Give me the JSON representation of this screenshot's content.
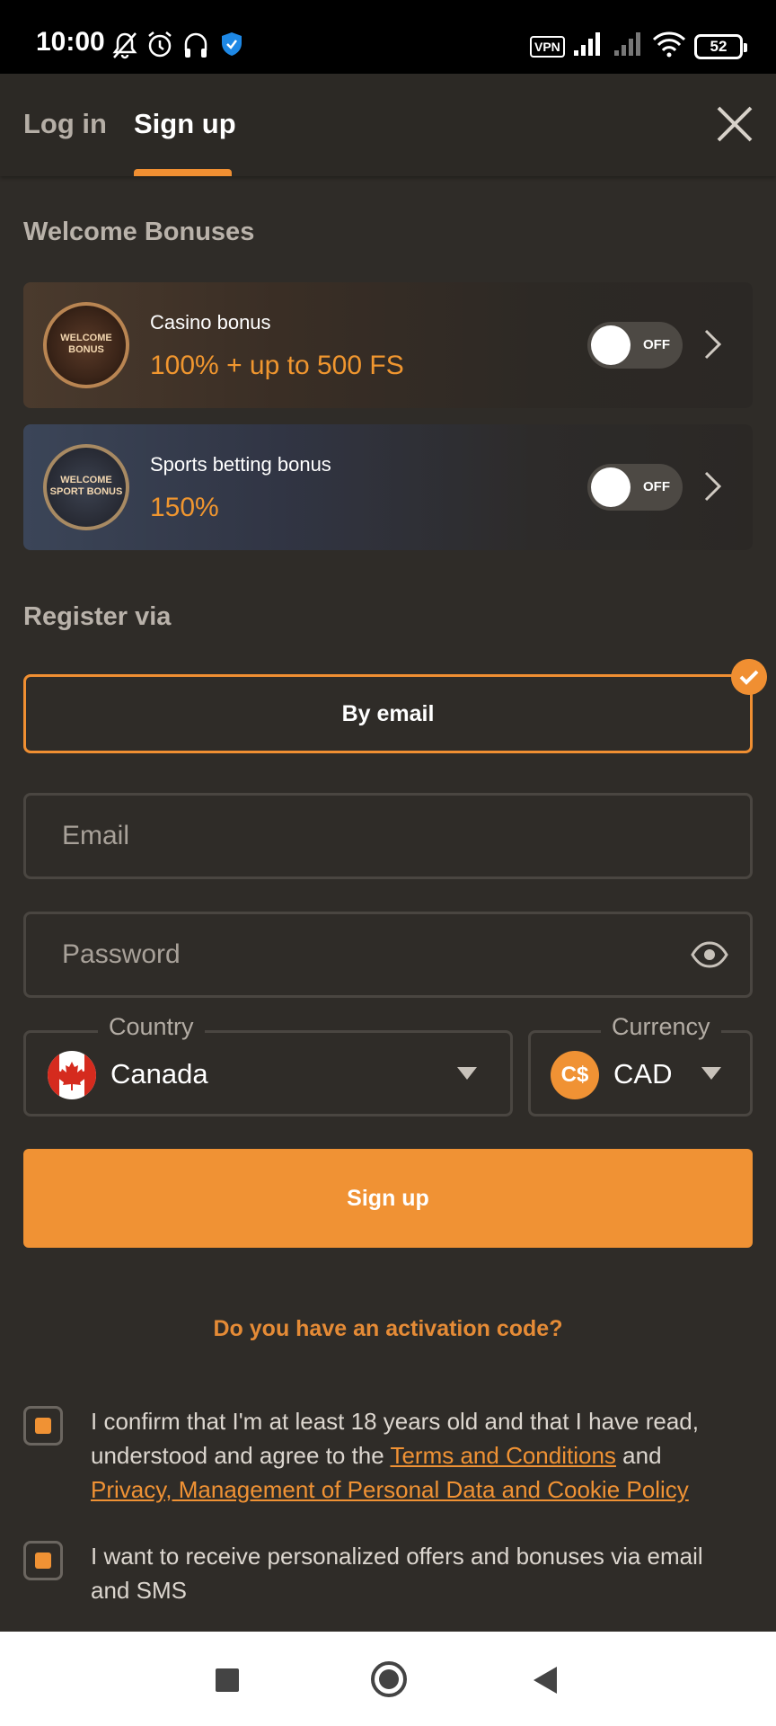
{
  "status_bar": {
    "time": "10:00",
    "vpn": "VPN",
    "battery": "52"
  },
  "header": {
    "tab_login": "Log in",
    "tab_signup": "Sign up"
  },
  "welcome": {
    "title": "Welcome Bonuses",
    "cards": [
      {
        "badge": "WELCOME BONUS",
        "label": "Casino bonus",
        "value": "100% + up to 500 FS",
        "toggle": "OFF"
      },
      {
        "badge": "WELCOME SPORT BONUS",
        "label": "Sports betting bonus",
        "value": "150%",
        "toggle": "OFF"
      }
    ]
  },
  "register": {
    "title": "Register via",
    "method": "By email",
    "email_placeholder": "Email",
    "password_placeholder": "Password",
    "country_label": "Country",
    "country_value": "Canada",
    "currency_label": "Currency",
    "currency_symbol": "C$",
    "currency_value": "CAD",
    "submit": "Sign up",
    "activation": "Do you have an activation code?"
  },
  "consent": {
    "age_text_1": "I confirm that I'm at least 18 years old and that I have read, understood and agree to the ",
    "terms_link": "Terms and Conditions",
    "age_text_2": " and ",
    "privacy_link": "Privacy, Management of Personal Data and Cookie Policy",
    "offers_text": "I want to receive personalized offers and bonuses via email and SMS"
  },
  "colors": {
    "accent": "#f09234",
    "background": "#2f2c28"
  }
}
